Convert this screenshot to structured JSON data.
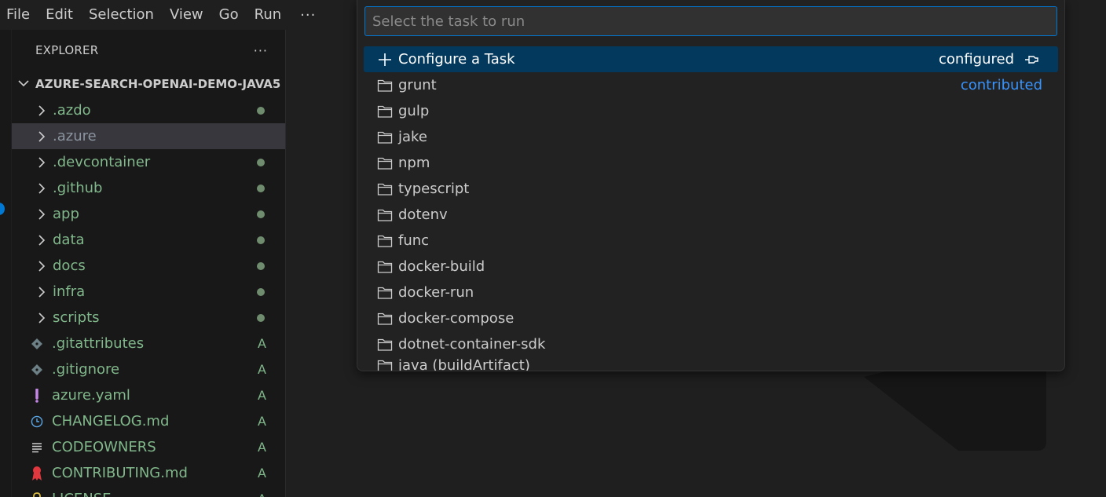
{
  "menubar": {
    "items": [
      "File",
      "Edit",
      "Selection",
      "View",
      "Go",
      "Run"
    ],
    "more": "···"
  },
  "sidebar": {
    "title": "EXPLORER",
    "more": "···",
    "root": "AZURE-SEARCH-OPENAI-DEMO-JAVA5",
    "folders": [
      {
        "label": ".azdo"
      },
      {
        "label": ".azure"
      },
      {
        "label": ".devcontainer"
      },
      {
        "label": ".github"
      },
      {
        "label": "app"
      },
      {
        "label": "data"
      },
      {
        "label": "docs"
      },
      {
        "label": "infra"
      },
      {
        "label": "scripts"
      }
    ],
    "files": [
      {
        "label": ".gitattributes",
        "badge": "A",
        "icon": "git-icon"
      },
      {
        "label": ".gitignore",
        "badge": "A",
        "icon": "git-icon"
      },
      {
        "label": "azure.yaml",
        "badge": "A",
        "icon": "exclamation-icon"
      },
      {
        "label": "CHANGELOG.md",
        "badge": "A",
        "icon": "clock-icon"
      },
      {
        "label": "CODEOWNERS",
        "badge": "A",
        "icon": "lines-icon"
      },
      {
        "label": "CONTRIBUTING.md",
        "badge": "A",
        "icon": "ribbon-icon"
      },
      {
        "label": "LICENSE",
        "badge": "A",
        "icon": "lock-icon"
      }
    ]
  },
  "quickpick": {
    "placeholder": "Select the task to run",
    "configure": {
      "label": "Configure a Task",
      "tag": "configured"
    },
    "items": [
      {
        "label": "grunt",
        "tag": "contributed"
      },
      {
        "label": "gulp",
        "tag": ""
      },
      {
        "label": "jake",
        "tag": ""
      },
      {
        "label": "npm",
        "tag": ""
      },
      {
        "label": "typescript",
        "tag": ""
      },
      {
        "label": "dotenv",
        "tag": ""
      },
      {
        "label": "func",
        "tag": ""
      },
      {
        "label": "docker-build",
        "tag": ""
      },
      {
        "label": "docker-run",
        "tag": ""
      },
      {
        "label": "docker-compose",
        "tag": ""
      },
      {
        "label": "dotnet-container-sdk",
        "tag": ""
      },
      {
        "label": "java (buildArtifact)",
        "tag": ""
      }
    ]
  },
  "colors": {
    "accent": "#0078d4",
    "selection": "#04395e",
    "git_added": "#81b88b",
    "link": "#3794ff"
  }
}
